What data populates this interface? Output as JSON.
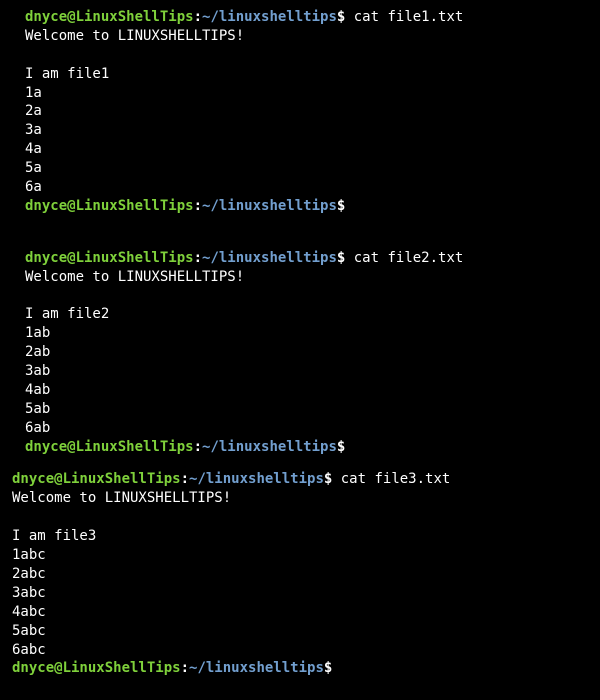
{
  "prompt": {
    "userHost": "dnyce@LinuxShellTips",
    "colon": ":",
    "path": "~/linuxshelltips",
    "dollar": "$"
  },
  "blocks": [
    {
      "command": "cat file1.txt",
      "output": [
        "Welcome to LINUXSHELLTIPS!",
        "",
        "I am file1",
        "1a",
        "2a",
        "3a",
        "4a",
        "5a",
        "6a"
      ],
      "trailingEmptyPrompt": true,
      "trailingBlank": true,
      "indent": true
    },
    {
      "command": "cat file2.txt",
      "output": [
        "Welcome to LINUXSHELLTIPS!",
        "",
        "I am file2",
        "1ab",
        "2ab",
        "3ab",
        "4ab",
        "5ab",
        "6ab"
      ],
      "trailingEmptyPrompt": true,
      "trailingBlank": false,
      "indent": true
    },
    {
      "command": "cat file3.txt",
      "output": [
        "Welcome to LINUXSHELLTIPS!",
        "",
        "I am file3",
        "1abc",
        "2abc",
        "3abc",
        "4abc",
        "5abc",
        "6abc"
      ],
      "trailingEmptyPrompt": true,
      "trailingBlank": false,
      "indent": false
    }
  ]
}
